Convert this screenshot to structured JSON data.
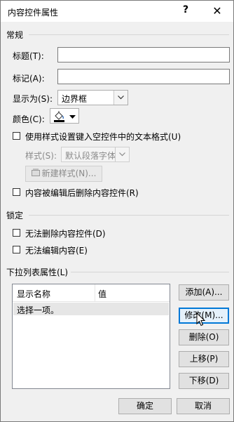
{
  "window": {
    "title": "内容控件属性",
    "help_glyph": "?",
    "close_glyph": "✕"
  },
  "general": {
    "section_label": "常规",
    "title_label": "标题(T):",
    "title_value": "",
    "tag_label": "标记(A):",
    "tag_value": "",
    "show_as_label": "显示为(S):",
    "show_as_value": "边界框",
    "color_label": "颜色(C):",
    "use_style_label": "使用样式设置键入空控件中的文本格式(U)",
    "use_style_checked": false,
    "style_label": "样式(S):",
    "style_value": "默认段落字体",
    "new_style_label": "新建样式(N)...",
    "delete_when_edited_label": "内容被编辑后删除内容控件(R)",
    "delete_when_edited_checked": false
  },
  "locking": {
    "section_label": "锁定",
    "cannot_delete_label": "无法删除内容控件(D)",
    "cannot_delete_checked": false,
    "cannot_edit_label": "无法编辑内容(E)",
    "cannot_edit_checked": false
  },
  "dropdown": {
    "section_label": "下拉列表属性(L)",
    "columns": [
      "显示名称",
      "值"
    ],
    "rows": [
      {
        "display_name": "选择一项。",
        "value": ""
      }
    ],
    "add_label": "添加(A)...",
    "modify_label": "修改(M)...",
    "delete_label": "删除(O)",
    "move_up_label": "上移(P)",
    "move_down_label": "下移(D)"
  },
  "footer": {
    "ok_label": "确定",
    "cancel_label": "取消"
  },
  "icons": {
    "dropdown_arrow": "chevron-down-icon",
    "color_picker": "paint-bucket-icon",
    "cursor": "mouse-pointer-icon"
  }
}
